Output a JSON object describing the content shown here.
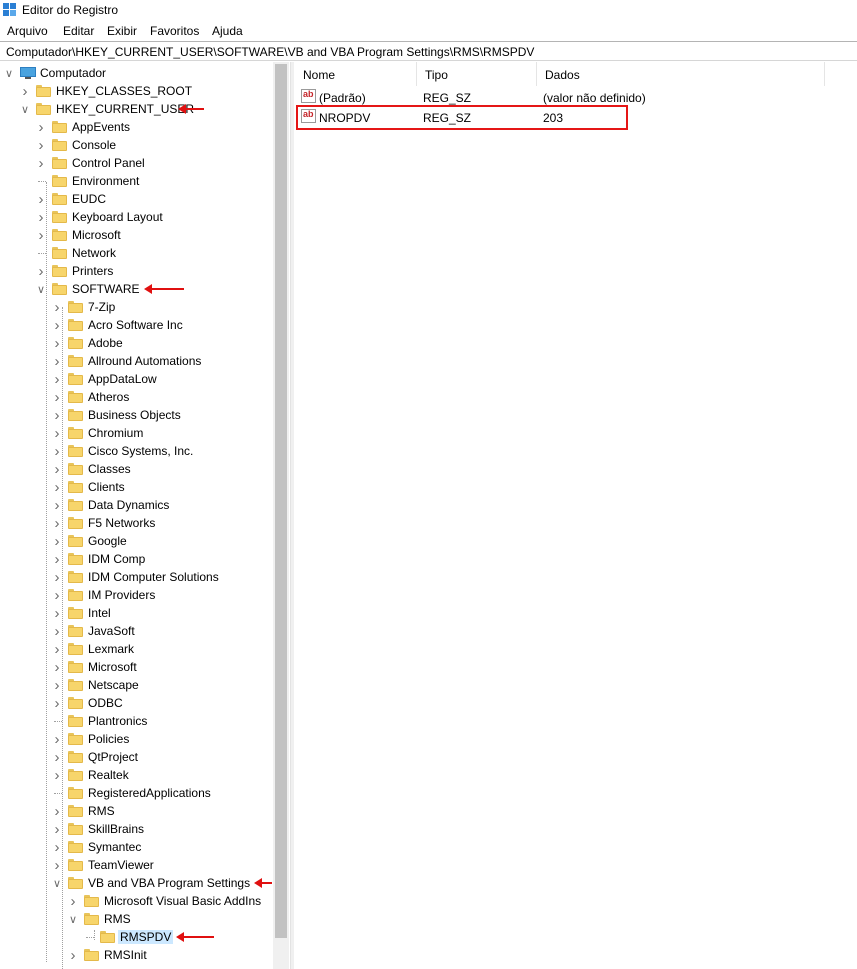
{
  "window": {
    "title": "Editor do Registro",
    "icon": "regedit-icon"
  },
  "menu": [
    "Arquivo",
    "Editar",
    "Exibir",
    "Favoritos",
    "Ajuda"
  ],
  "address": "Computador\\HKEY_CURRENT_USER\\SOFTWARE\\VB and VBA Program Settings\\RMS\\RMSPDV",
  "tree": {
    "root": "Computador",
    "hives": [
      "HKEY_CLASSES_ROOT",
      "HKEY_CURRENT_USER"
    ],
    "hkcu_children": [
      "AppEvents",
      "Console",
      "Control Panel",
      "Environment",
      "EUDC",
      "Keyboard Layout",
      "Microsoft",
      "Network",
      "Printers",
      "SOFTWARE"
    ],
    "software_children": [
      "7-Zip",
      "Acro Software Inc",
      "Adobe",
      "Allround Automations",
      "AppDataLow",
      "Atheros",
      "Business Objects",
      "Chromium",
      "Cisco Systems, Inc.",
      "Classes",
      "Clients",
      "Data Dynamics",
      "F5 Networks",
      "Google",
      "IDM Comp",
      "IDM Computer Solutions",
      "IM Providers",
      "Intel",
      "JavaSoft",
      "Lexmark",
      "Microsoft",
      "Netscape",
      "ODBC",
      "Plantronics",
      "Policies",
      "QtProject",
      "Realtek",
      "RegisteredApplications",
      "RMS",
      "SkillBrains",
      "Symantec",
      "TeamViewer",
      "VB and VBA Program Settings"
    ],
    "vb_children": [
      "Microsoft Visual Basic AddIns",
      "RMS"
    ],
    "rms_children": [
      "RMSPDV"
    ],
    "vb_children_after": [
      "RMSInit"
    ],
    "selected": "RMSPDV"
  },
  "list": {
    "columns": [
      "Nome",
      "Tipo",
      "Dados"
    ],
    "rows": [
      {
        "name": "(Padrão)",
        "type": "REG_SZ",
        "data": "(valor não definido)"
      },
      {
        "name": "NROPDV",
        "type": "REG_SZ",
        "data": "203"
      }
    ]
  },
  "colors": {
    "annotation": "#e01010",
    "selection": "#cce8ff"
  }
}
